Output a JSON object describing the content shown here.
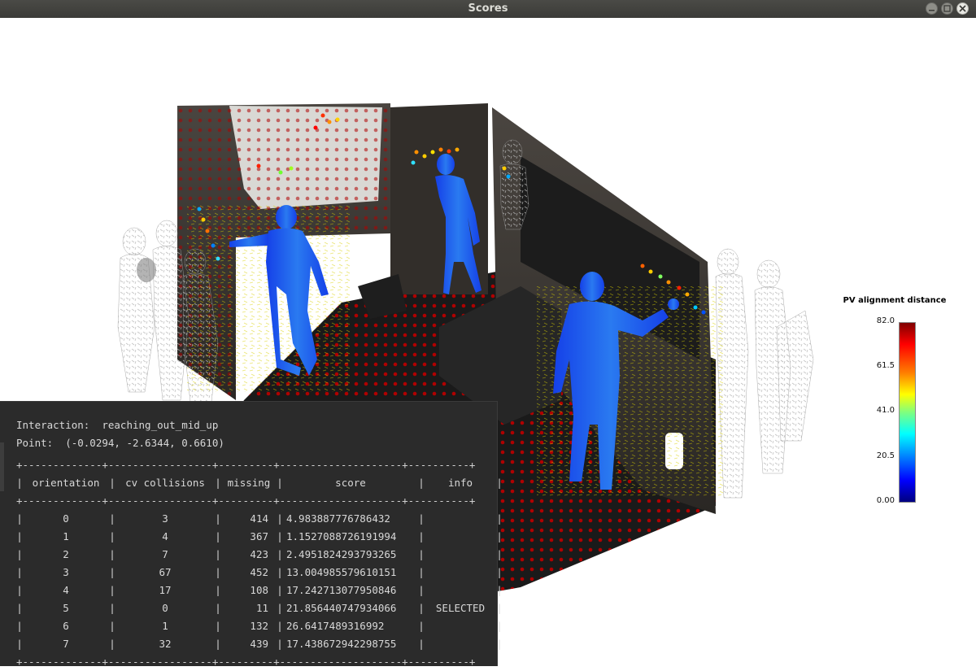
{
  "window": {
    "title": "Scores"
  },
  "colorbar": {
    "title": "PV alignment distance",
    "ticks": [
      "82.0",
      "61.5",
      "41.0",
      "20.5",
      "0.00"
    ],
    "min": 0.0,
    "max": 82.0
  },
  "terminal": {
    "interaction_line": "Interaction:  reaching_out_mid_up",
    "point_line": "Point:  (-0.0294, -2.6344, 0.6610)",
    "separator": "+-------------+-----------------+---------+--------------------+----------+",
    "headers": [
      "orientation",
      "cv collisions",
      "missing",
      "score",
      "info"
    ],
    "rows": [
      {
        "orientation": "0",
        "cv_collisions": "3",
        "missing": "414",
        "score": "4.983887776786432",
        "info": ""
      },
      {
        "orientation": "1",
        "cv_collisions": "4",
        "missing": "367",
        "score": "1.1527088726191994",
        "info": ""
      },
      {
        "orientation": "2",
        "cv_collisions": "7",
        "missing": "423",
        "score": "2.4951824293793265",
        "info": ""
      },
      {
        "orientation": "3",
        "cv_collisions": "67",
        "missing": "452",
        "score": "13.004985579610151",
        "info": ""
      },
      {
        "orientation": "4",
        "cv_collisions": "17",
        "missing": "108",
        "score": "17.242713077950846",
        "info": ""
      },
      {
        "orientation": "5",
        "cv_collisions": "0",
        "missing": "11",
        "score": "21.856440747934066",
        "info": "SELECTED"
      },
      {
        "orientation": "6",
        "cv_collisions": "1",
        "missing": "132",
        "score": "26.6417489316992",
        "info": ""
      },
      {
        "orientation": "7",
        "cv_collisions": "32",
        "missing": "439",
        "score": "17.438672942298755",
        "info": ""
      }
    ]
  }
}
